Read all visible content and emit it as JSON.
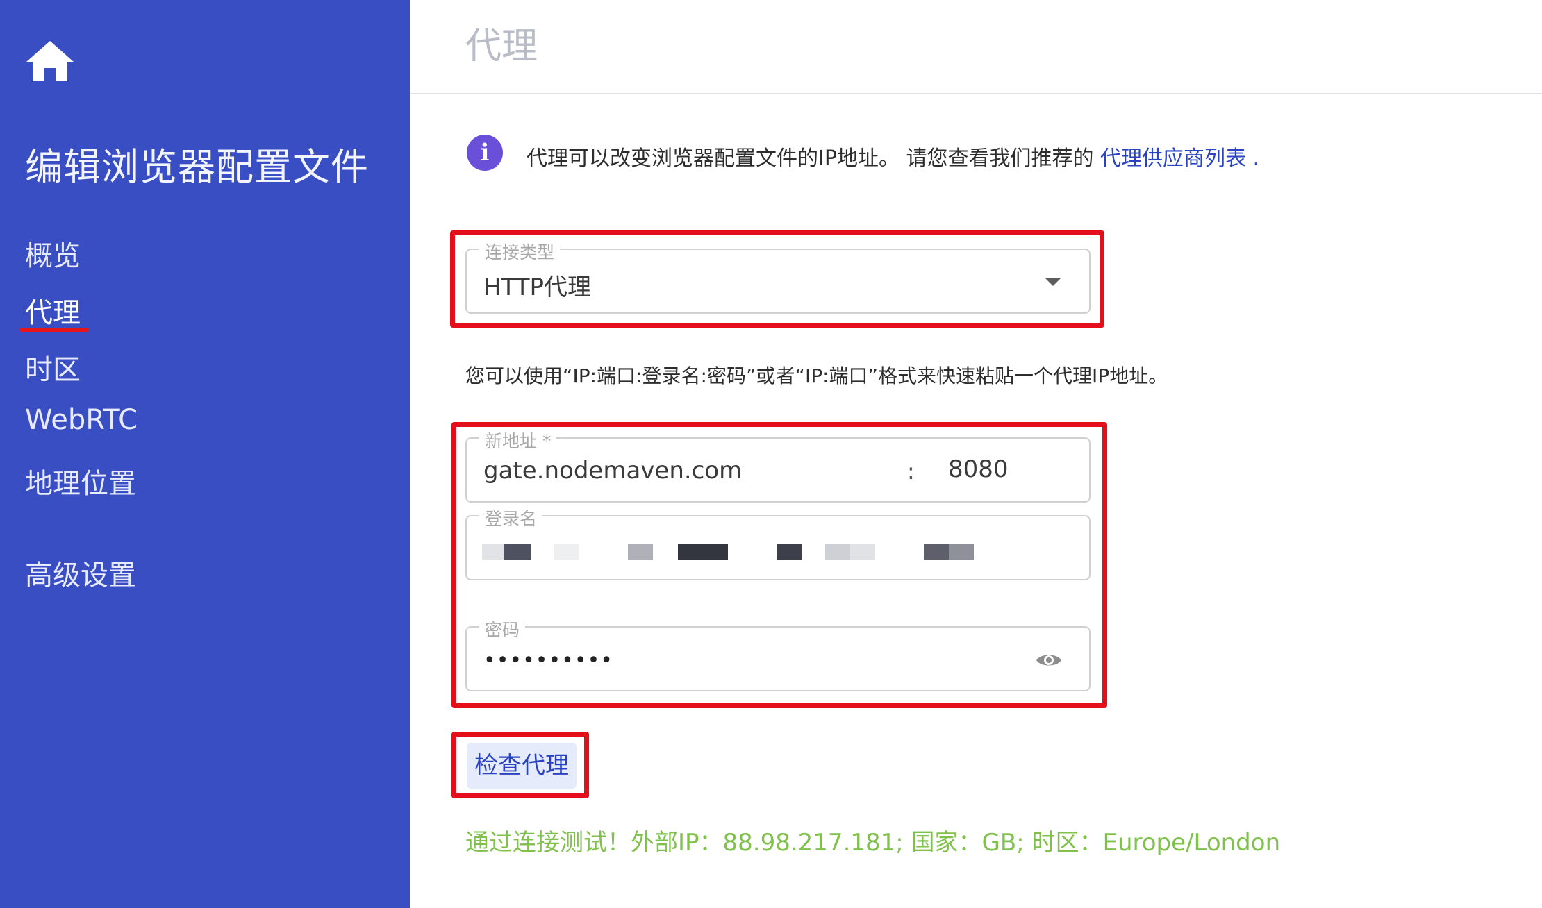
{
  "sidebar": {
    "home_icon": "home-icon",
    "title": "编辑浏览器配置文件",
    "items": [
      {
        "label": "概览",
        "active": false
      },
      {
        "label": "代理",
        "active": true
      },
      {
        "label": "时区",
        "active": false
      },
      {
        "label": "WebRTC",
        "active": false
      },
      {
        "label": "地理位置",
        "active": false
      },
      {
        "label": "高级设置",
        "active": false
      }
    ]
  },
  "header": {
    "title": "代理"
  },
  "info": {
    "icon": "info-icon",
    "text": "代理可以改变浏览器配置文件的IP地址。 请您查看我们推荐的 ",
    "link": "代理供应商列表",
    "dot": " ."
  },
  "connection_type": {
    "label": "连接类型",
    "value": "HTTP代理"
  },
  "hint": "您可以使用“IP:端口:登录名:密码”或者“IP:端口”格式来快速粘贴一个代理IP地址。",
  "address": {
    "label": "新地址 *",
    "host": "gate.nodemaven.com",
    "separator": ":",
    "port": "8080"
  },
  "login": {
    "label": "登录名"
  },
  "password": {
    "label": "密码",
    "value": "••••••••••",
    "toggle_icon": "eye-icon"
  },
  "check_button": "检查代理",
  "result": "通过连接测试！外部IP：88.98.217.181; 国家：GB; 时区：Europe/London",
  "colors": {
    "sidebar_bg": "#394ec3",
    "accent": "#2a43c2",
    "highlight": "#e50f1b",
    "success": "#7fc14b"
  }
}
